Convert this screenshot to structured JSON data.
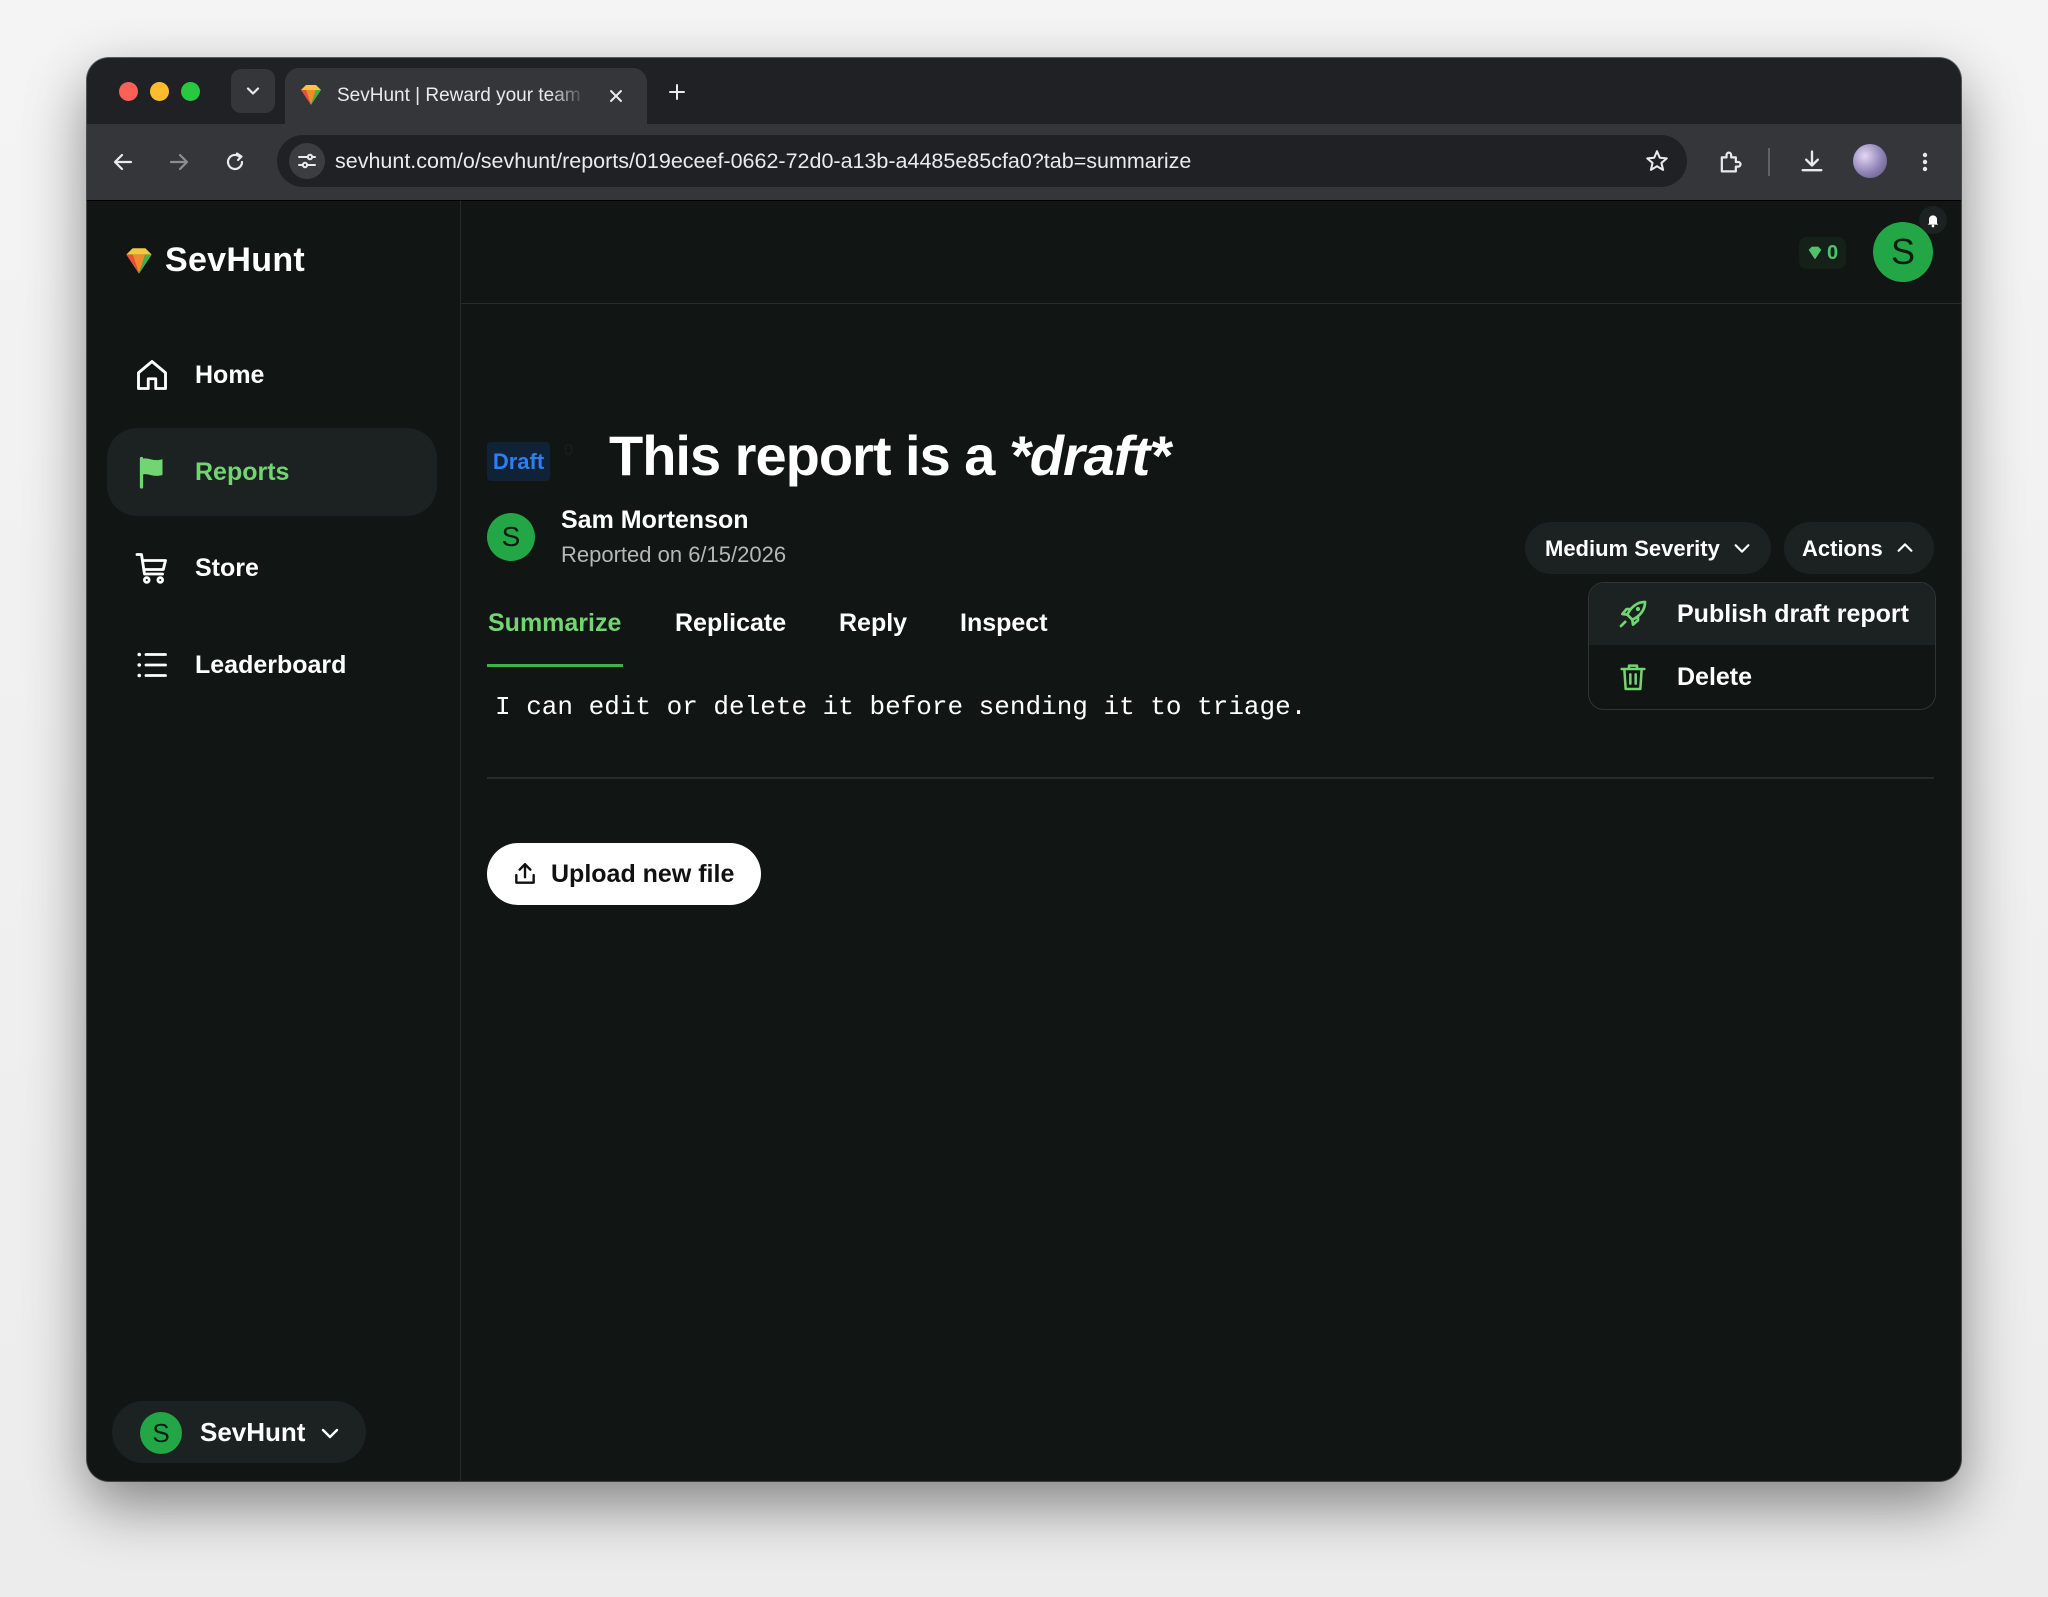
{
  "browser": {
    "tab_title": "SevHunt | Reward your team for finding bugs",
    "url": "sevhunt.com/o/sevhunt/reports/019eceef-0662-72d0-a13b-a4485e85cfa0?tab=summarize"
  },
  "sidebar": {
    "brand": "SevHunt",
    "items": [
      {
        "label": "Home",
        "icon": "home-icon",
        "active": false
      },
      {
        "label": "Reports",
        "icon": "flag-icon",
        "active": true
      },
      {
        "label": "Store",
        "icon": "cart-icon",
        "active": false
      },
      {
        "label": "Leaderboard",
        "icon": "list-icon",
        "active": false
      }
    ],
    "org": {
      "avatar_letter": "S",
      "name": "SevHunt"
    }
  },
  "topbar": {
    "gem_count": "0",
    "user_avatar_letter": "S"
  },
  "report": {
    "status_badge": "Draft",
    "status_count": "0",
    "title_prefix": "This report is a ",
    "title_emphasis": "*draft*",
    "author": {
      "avatar_letter": "S",
      "name": "Sam Mortenson",
      "reported": "Reported on 6/15/2026"
    },
    "severity_label": "Medium Severity",
    "actions_label": "Actions",
    "actions_menu": [
      {
        "label": "Publish draft report",
        "icon": "rocket-icon"
      },
      {
        "label": "Delete",
        "icon": "trash-icon"
      }
    ],
    "tabs": [
      {
        "label": "Summarize",
        "active": true
      },
      {
        "label": "Replicate",
        "active": false
      },
      {
        "label": "Reply",
        "active": false
      },
      {
        "label": "Inspect",
        "active": false
      }
    ],
    "summary_text": "I can edit or delete it before sending it to triage.",
    "upload_label": "Upload new file"
  },
  "colors": {
    "accent_green": "#72d572",
    "avatar_green": "#22a646",
    "draft_blue": "#2f7ef0",
    "background": "#111615"
  }
}
